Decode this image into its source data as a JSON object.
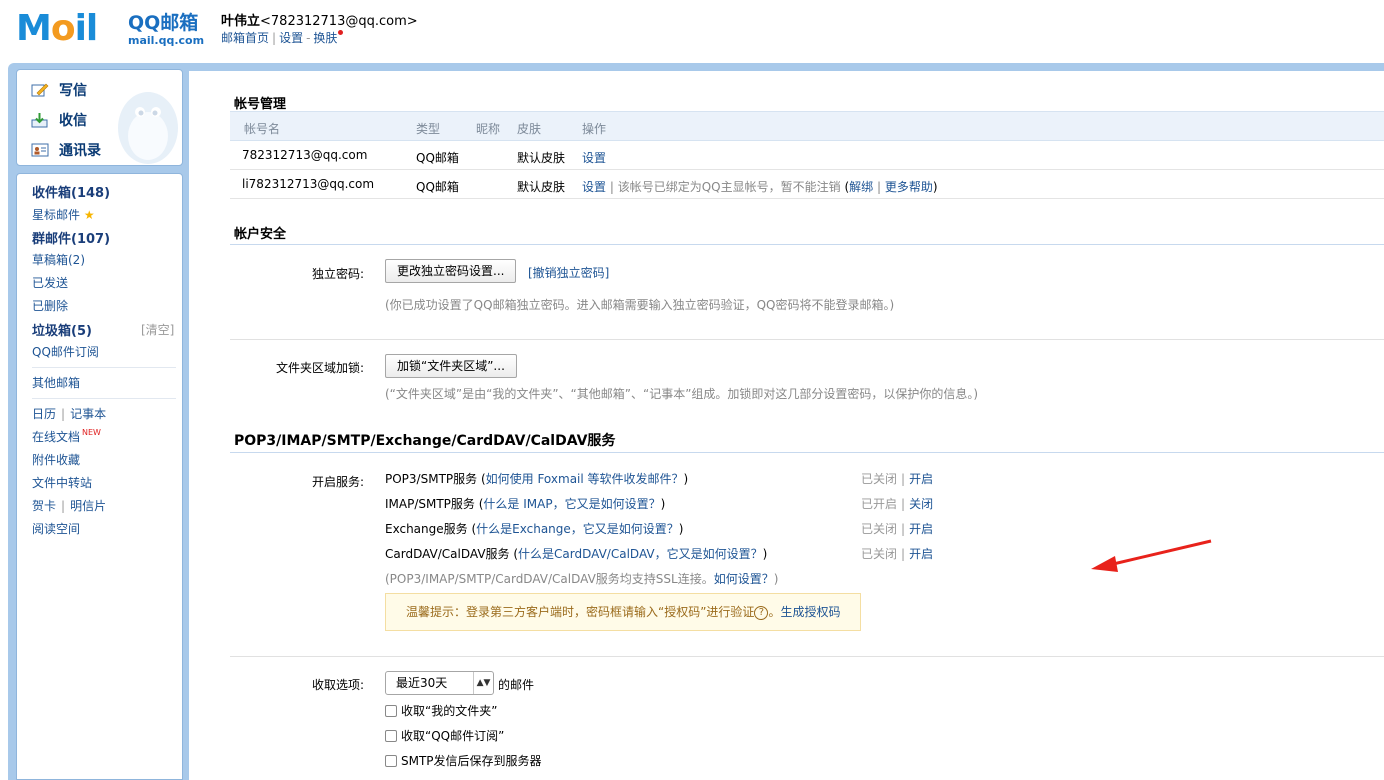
{
  "header": {
    "logo_brand": "QQ邮箱",
    "logo_domain": "mail.qq.com",
    "user_display": "叶伟立",
    "user_email": "<782312713@qq.com>",
    "links": [
      "邮箱首页",
      "设置",
      "换肤"
    ]
  },
  "quick_actions": [
    "写信",
    "收信",
    "通讯录"
  ],
  "folders": {
    "inbox": "收件箱(148)",
    "starred": "星标邮件",
    "group": "群邮件(107)",
    "drafts": "草稿箱(2)",
    "sent": "已发送",
    "deleted": "已删除",
    "spam": "垃圾箱(5)",
    "spam_clear": "[清空]",
    "subscriptions": "QQ邮件订阅",
    "other_mailboxes": "其他邮箱",
    "calendar": "日历",
    "notes": "记事本",
    "docs": "在线文档",
    "docs_badge": "NEW",
    "attachments": "附件收藏",
    "transfer": "文件中转站",
    "cards": "贺卡",
    "postcards": "明信片",
    "reading": "阅读空间"
  },
  "accounts": {
    "title": "帐号管理",
    "columns": [
      "帐号名",
      "类型",
      "昵称",
      "皮肤",
      "操作"
    ],
    "rows": [
      {
        "name": "782312713@qq.com",
        "type": "QQ邮箱",
        "nickname": "",
        "skin": "默认皮肤",
        "action": "设置",
        "note": ""
      },
      {
        "name": "li782312713@qq.com",
        "type": "QQ邮箱",
        "nickname": "",
        "skin": "默认皮肤",
        "action": "设置",
        "note": "该帐号已绑定为QQ主显帐号，暂不能注销",
        "unbind": "解绑",
        "help": "更多帮助"
      }
    ]
  },
  "security": {
    "title": "帐户安全",
    "password_label": "独立密码:",
    "password_button": "更改独立密码设置...",
    "password_cancel": "[撤销独立密码]",
    "password_note": "(你已成功设置了QQ邮箱独立密码。进入邮箱需要输入独立密码验证，QQ密码将不能登录邮箱。)",
    "folder_lock_label": "文件夹区域加锁:",
    "folder_lock_button": "加锁“文件夹区域”...",
    "folder_lock_note": "(“文件夹区域”是由“我的文件夹”、“其他邮箱”、“记事本”组成。加锁即对这几部分设置密码，以保护你的信息。)"
  },
  "protocols": {
    "title": "POP3/IMAP/SMTP/Exchange/CardDAV/CalDAV服务",
    "label": "开启服务:",
    "services": [
      {
        "name": "POP3/SMTP服务",
        "help": "如何使用 Foxmail 等软件收发邮件？",
        "state": "已关闭",
        "action": "开启"
      },
      {
        "name": "IMAP/SMTP服务",
        "help": "什么是 IMAP，它又是如何设置？",
        "state": "已开启",
        "action": "关闭"
      },
      {
        "name": "Exchange服务",
        "help": "什么是Exchange，它又是如何设置？",
        "state": "已关闭",
        "action": "开启"
      },
      {
        "name": "CardDAV/CalDAV服务",
        "help": "什么是CardDAV/CalDAV，它又是如何设置？",
        "state": "已关闭",
        "action": "开启"
      }
    ],
    "ssl_note": "(POP3/IMAP/SMTP/CardDAV/CalDAV服务均支持SSL连接。",
    "ssl_link": "如何设置？",
    "tip_text": "温馨提示：登录第三方客户端时，密码框请输入“授权码”进行验证",
    "tip_link": "生成授权码"
  },
  "receive": {
    "label": "收取选项:",
    "range": "最近30天",
    "suffix": "的邮件",
    "options": [
      "收取“我的文件夹”",
      "收取“QQ邮件订阅”",
      "SMTP发信后保存到服务器"
    ]
  }
}
